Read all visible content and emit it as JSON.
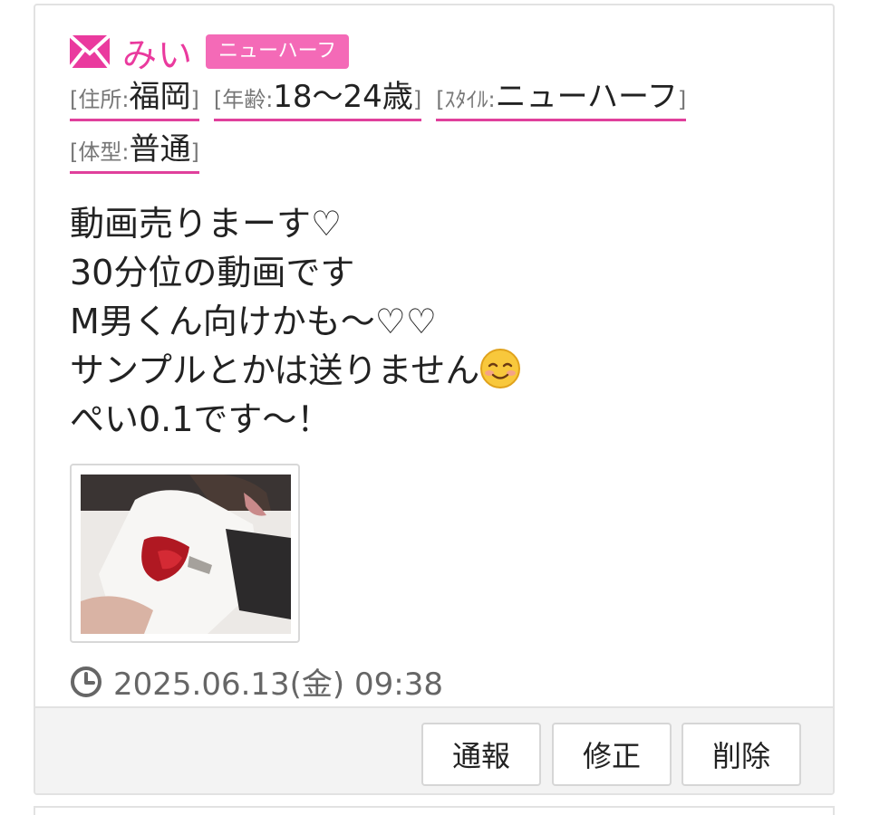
{
  "post": {
    "name": "みい",
    "type_badge": "ニューハーフ",
    "icon": "mail-icon",
    "accent_color": "#ea3a9e",
    "attributes": [
      {
        "label": "[住所:",
        "value": "福岡",
        "close": "]"
      },
      {
        "label": "[年齢:",
        "value": "18〜24歳",
        "close": "]"
      },
      {
        "label": "[ｽﾀｲﾙ:",
        "value": "ニューハーフ",
        "close": "]"
      },
      {
        "label": "[体型:",
        "value": "普通",
        "close": "]"
      }
    ],
    "message_lines": [
      "動画売りまーす♡",
      "30分位の動画です",
      "M男くん向けかも〜♡♡",
      "サンプルとかは送りません",
      "ぺい0.1です〜！"
    ],
    "message_emoji": "smiling-face-emoji",
    "timestamp": "2025.06.13(金) 09:38"
  },
  "actions": {
    "report_label": "通報",
    "edit_label": "修正",
    "delete_label": "削除"
  }
}
